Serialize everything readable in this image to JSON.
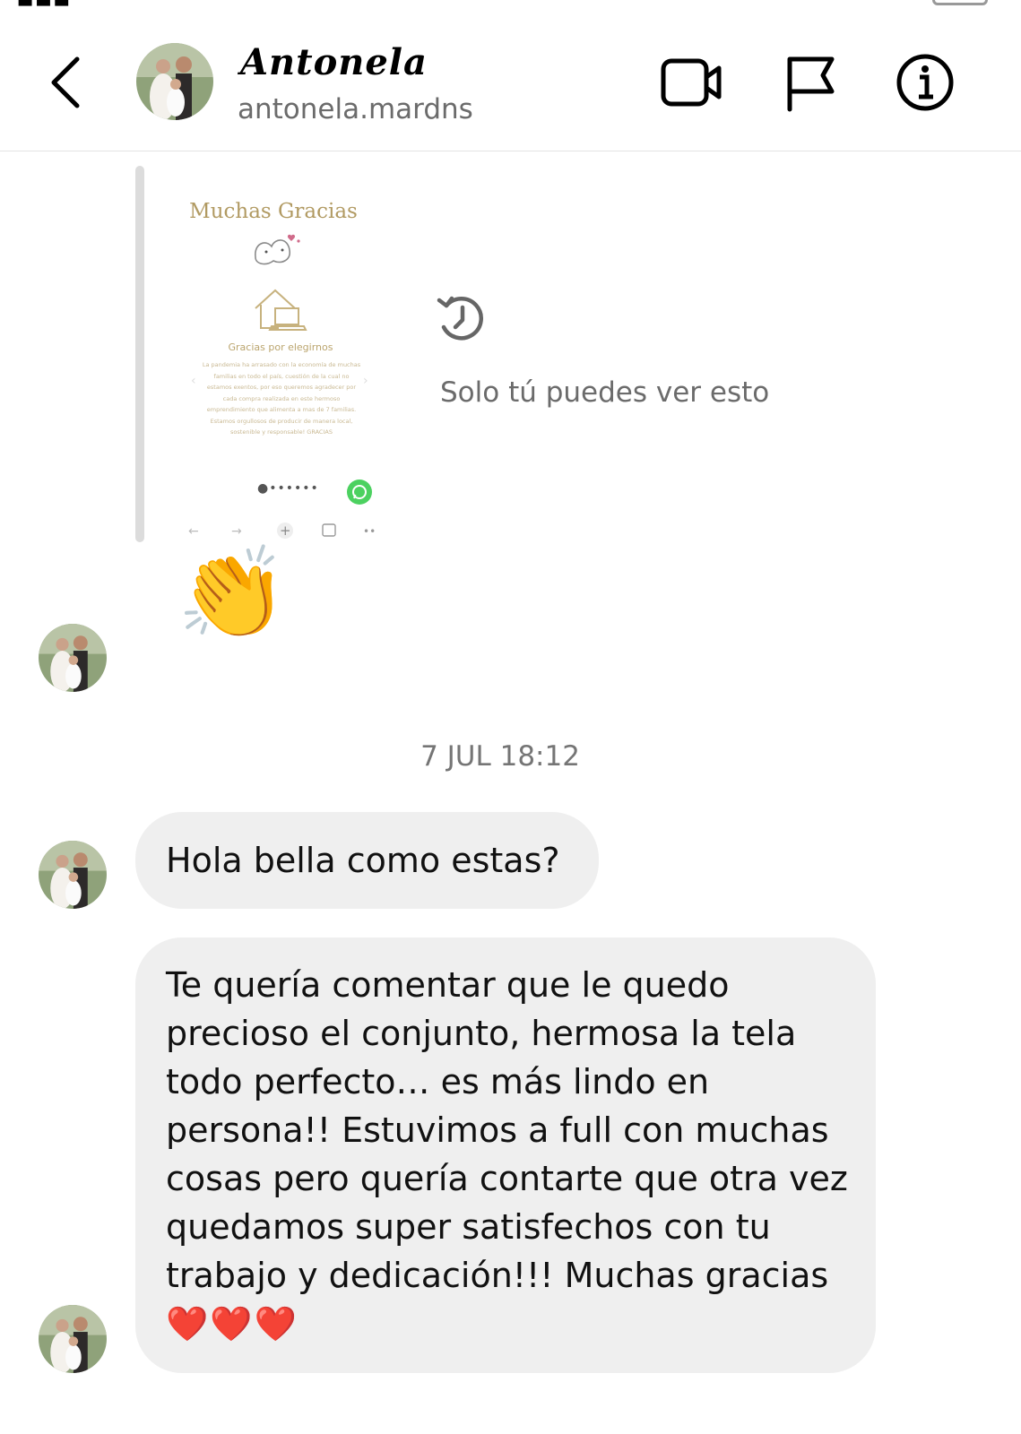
{
  "header": {
    "display_name": "Antonela",
    "username": "antonela.mardns",
    "icons": [
      "chevron-left-icon",
      "video-camera-icon",
      "flag-icon",
      "info-icon"
    ]
  },
  "story": {
    "title": "Muchas Gracias",
    "subtitle": "Gracias por elegirnos",
    "body": "La pandemia ha arrasado con la economía de muchas familias en todo el país, cuestión de la cual no estamos exentos, por eso queremos agradecer por cada compra realizada en este hermoso emprendimiento que alimenta a mas de 7 familias. Estamos orgullosos de producir de manera local, sostenible y responsable! GRACIAS",
    "notice": "Solo tú puedes ver esto"
  },
  "messages": {
    "reaction_emoji": "👏",
    "timestamp": "7 JUL 18:12",
    "msg1": "Hola bella como estas?",
    "msg2_text": "Te quería comentar que le quedo precioso el conjunto, hermosa la tela todo perfecto… es más lindo en persona!! Estuvimos a full con muchas cosas pero quería contarte que otra vez quedamos super satisfechos con tu trabajo y dedicación!!! Muchas gracias",
    "msg2_hearts": "❤️❤️❤️"
  },
  "colors": {
    "bubble": "#efefef",
    "muted_text": "#6b6b6b",
    "story_gold": "#b19a62",
    "whatsapp": "#4cd160"
  }
}
